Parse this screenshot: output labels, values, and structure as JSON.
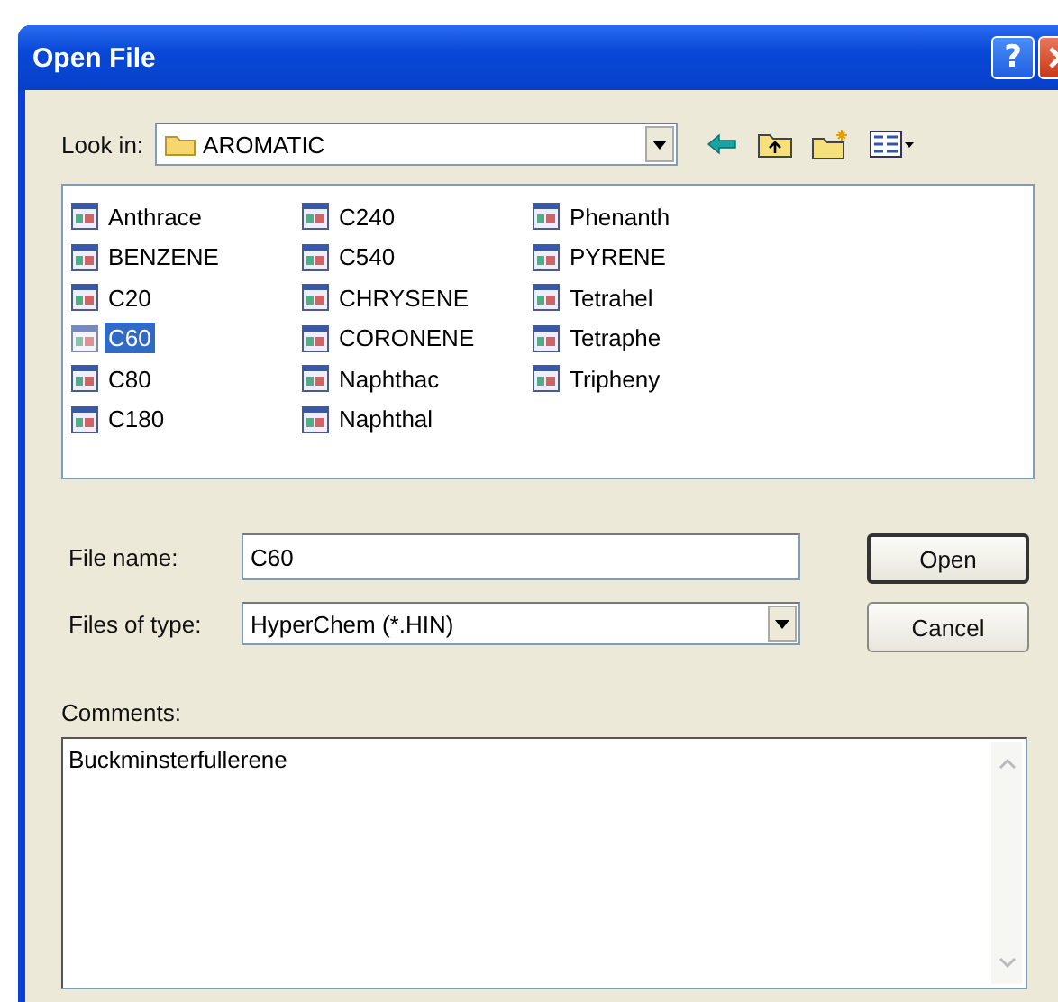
{
  "window": {
    "title": "Open File",
    "help_glyph": "?"
  },
  "look_in": {
    "label": "Look in:",
    "value": "AROMATIC"
  },
  "files": [
    {
      "name": "Anthrace",
      "selected": false
    },
    {
      "name": "BENZENE",
      "selected": false
    },
    {
      "name": "C20",
      "selected": false
    },
    {
      "name": "C60",
      "selected": true
    },
    {
      "name": "C80",
      "selected": false
    },
    {
      "name": "C180",
      "selected": false
    },
    {
      "name": "C240",
      "selected": false
    },
    {
      "name": "C540",
      "selected": false
    },
    {
      "name": "CHRYSENE",
      "selected": false
    },
    {
      "name": "CORONENE",
      "selected": false
    },
    {
      "name": "Naphthac",
      "selected": false
    },
    {
      "name": "Naphthal",
      "selected": false
    },
    {
      "name": "Phenanth",
      "selected": false
    },
    {
      "name": "PYRENE",
      "selected": false
    },
    {
      "name": "Tetrahel",
      "selected": false
    },
    {
      "name": "Tetraphe",
      "selected": false
    },
    {
      "name": "Tripheny",
      "selected": false
    }
  ],
  "file_name": {
    "label": "File name:",
    "value": "C60"
  },
  "file_type": {
    "label": "Files of type:",
    "value": "HyperChem (*.HIN)"
  },
  "buttons": [
    "Open",
    "Cancel"
  ],
  "comments": {
    "label": "Comments:",
    "value": "Buckminsterfullerene"
  }
}
